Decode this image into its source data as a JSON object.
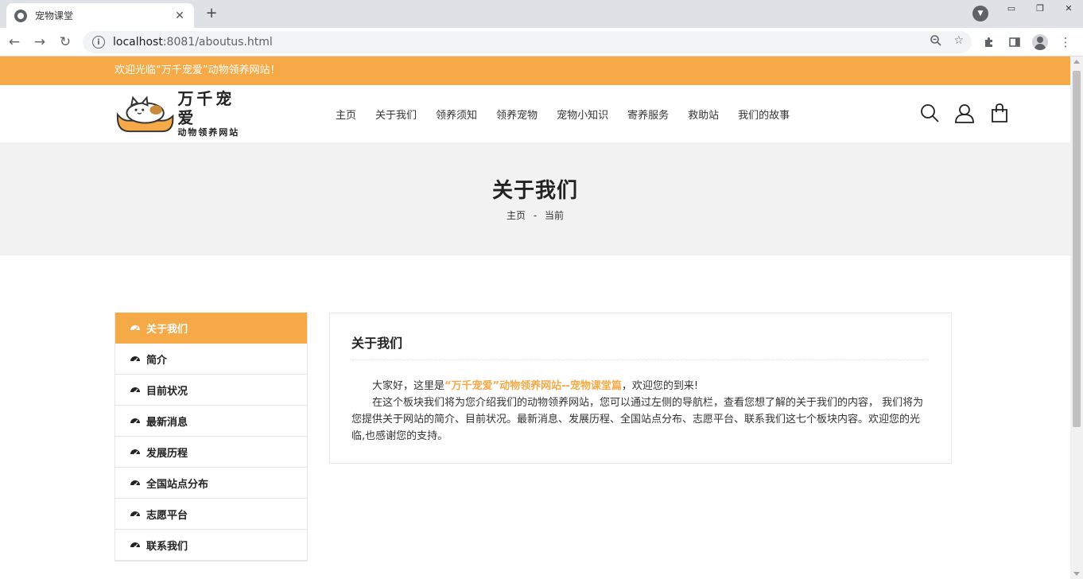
{
  "browser": {
    "tab_title": "宠物课堂",
    "url_host": "localhost",
    "url_rest": ":8081/aboutus.html"
  },
  "site": {
    "welcome": "欢迎光临“万千宠爱”动物领养网站！",
    "logo_title": "万千宠爱",
    "logo_subtitle": "动物领养网站",
    "menu": [
      "主页",
      "关于我们",
      "领养须知",
      "领养宠物",
      "宠物小知识",
      "寄养服务",
      "救助站",
      "我们的故事"
    ]
  },
  "banner": {
    "title": "关于我们",
    "crumb_home": "主页",
    "crumb_sep": "-",
    "crumb_current": "当前"
  },
  "sidebar": {
    "items": [
      "关于我们",
      "简介",
      "目前状况",
      "最新消息",
      "发展历程",
      "全国站点分布",
      "志愿平台",
      "联系我们"
    ]
  },
  "panel": {
    "title": "关于我们",
    "p1_before": "大家好，这里是",
    "p1_highlight": "“万千宠爱”动物领养网站--宠物课堂篇",
    "p1_after": "，欢迎您的到来!",
    "p2": "在这个板块我们将为您介绍我们的动物领养网站，您可以通过左侧的导航栏，查看您想了解的关于我们的内容， 我们将为您提供关于网站的简介、目前状况。最新消息、发展历程、全国站点分布、志愿平台、联系我们这七个板块内容。欢迎您的光临,也感谢您的支持。"
  },
  "colors": {
    "accent": "#f5a947",
    "banner_bg": "#f2f2f2"
  }
}
